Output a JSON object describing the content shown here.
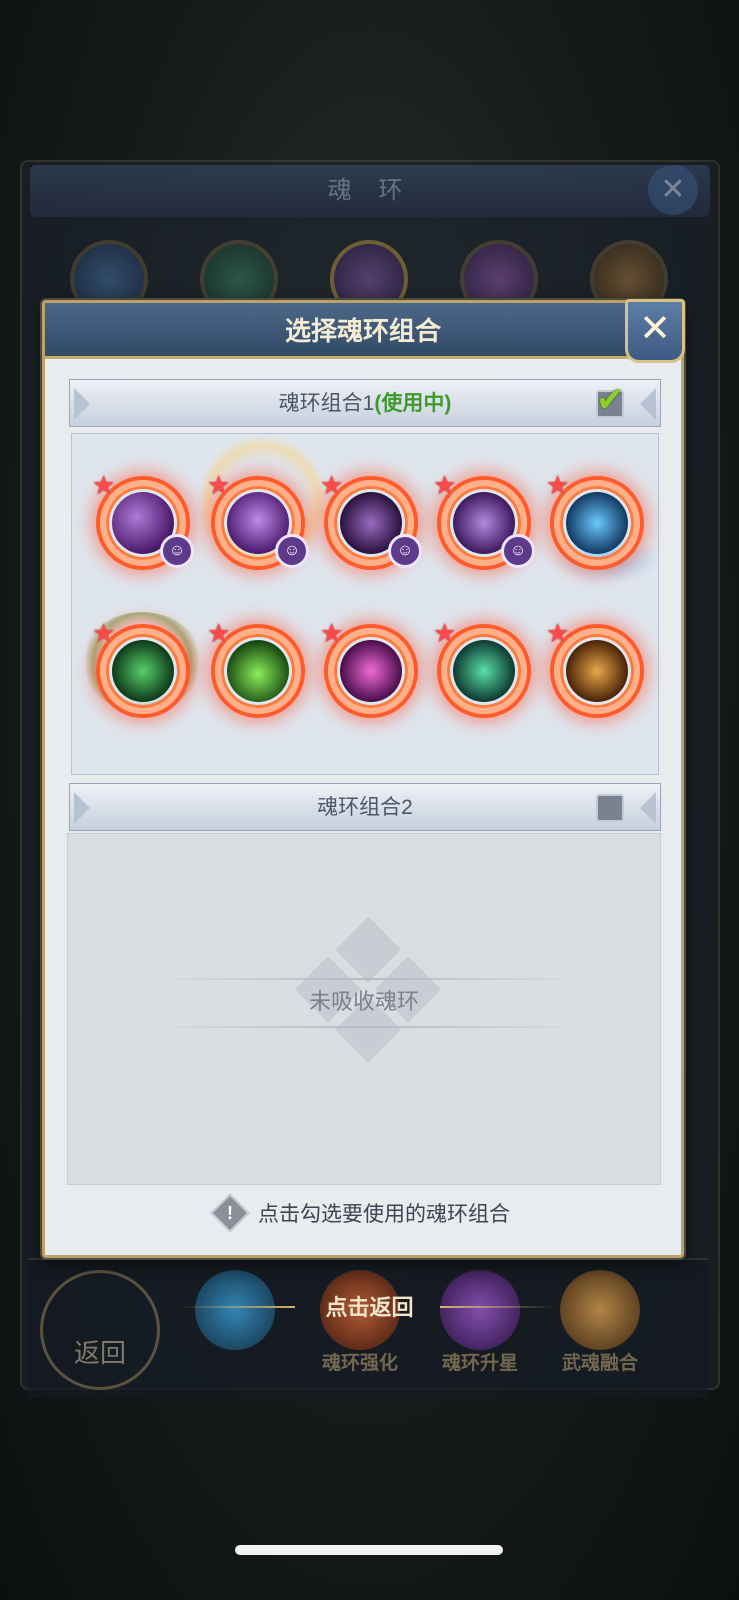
{
  "background": {
    "title": "魂 环",
    "bottom_tabs": [
      "",
      "魂环强化",
      "魂环升星",
      "武魂融合"
    ],
    "back_label": "返回",
    "tap_return": "点击返回"
  },
  "dialog": {
    "title": "选择魂环组合",
    "close_glyph": "✕"
  },
  "group1": {
    "label": "魂环组合1",
    "status": "(使用中)",
    "checked": true,
    "check_glyph": "✔",
    "rings": [
      {
        "icon": "shadow-claw-icon",
        "badge": "☺"
      },
      {
        "icon": "purple-witch-icon",
        "badge": "☺"
      },
      {
        "icon": "dark-spirit-icon",
        "badge": "☺"
      },
      {
        "icon": "purple-pig-icon",
        "badge": "☺"
      },
      {
        "icon": "blue-lightning-icon",
        "badge": ""
      },
      {
        "icon": "green-demon-icon",
        "badge": ""
      },
      {
        "icon": "green-sprout-icon",
        "badge": ""
      },
      {
        "icon": "pink-slash-icon",
        "badge": ""
      },
      {
        "icon": "green-wings-icon",
        "badge": ""
      },
      {
        "icon": "golden-beast-icon",
        "badge": ""
      }
    ]
  },
  "group2": {
    "label": "魂环组合2",
    "checked": false,
    "empty_text": "未吸收魂环"
  },
  "hint": {
    "icon_glyph": "!",
    "text": "点击勾选要使用的魂环组合"
  },
  "colors": {
    "ring_outer": "#ff5a2a",
    "in_use": "#3f9a2e",
    "header_blue": "#3e5a82"
  }
}
